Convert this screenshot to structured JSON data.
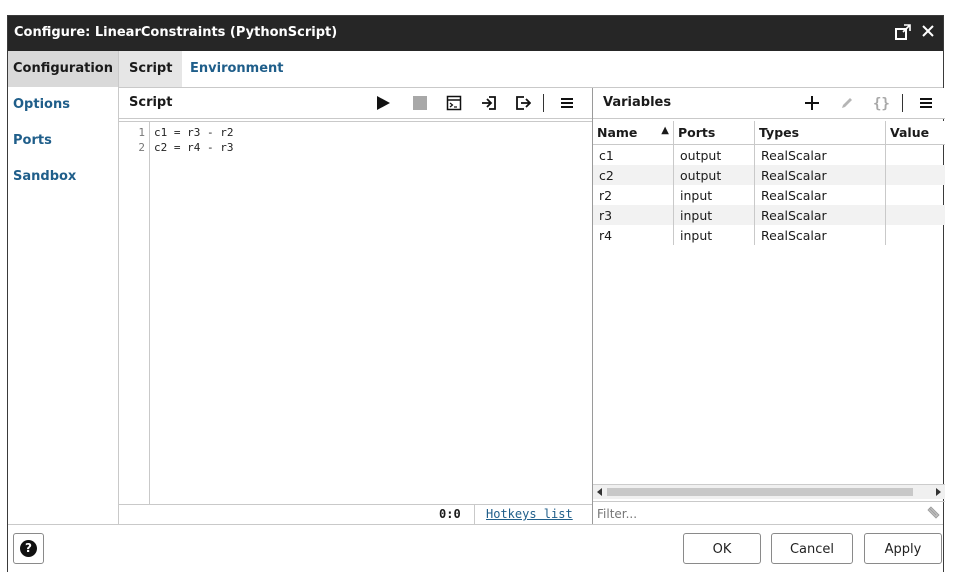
{
  "window": {
    "title": "Configure: LinearConstraints (PythonScript)"
  },
  "sidebar": {
    "items": [
      {
        "label": "Configuration",
        "active": true
      },
      {
        "label": "Options",
        "active": false
      },
      {
        "label": "Ports",
        "active": false
      },
      {
        "label": "Sandbox",
        "active": false
      }
    ]
  },
  "tabs": [
    {
      "label": "Script",
      "active": true
    },
    {
      "label": "Environment",
      "active": false
    }
  ],
  "script_pane": {
    "title": "Script",
    "toolbar_icons": [
      "run-icon",
      "stop-icon",
      "console-icon",
      "import-icon",
      "export-icon",
      "menu-icon"
    ],
    "lines": [
      {
        "num": "1",
        "code": "c1 = r3 - r2"
      },
      {
        "num": "2",
        "code": "c2 = r4 - r3"
      }
    ],
    "cursor_position": "0:0",
    "hotkeys_link": "Hotkeys list"
  },
  "variables_pane": {
    "title": "Variables",
    "toolbar_icons": [
      "add-icon",
      "edit-icon",
      "braces-icon",
      "menu-icon"
    ],
    "columns": [
      "Name",
      "Ports",
      "Types",
      "Value"
    ],
    "sort_indicator": "▲",
    "rows": [
      [
        "c1",
        "output",
        "RealScalar",
        ""
      ],
      [
        "c2",
        "output",
        "RealScalar",
        ""
      ],
      [
        "r2",
        "input",
        "RealScalar",
        ""
      ],
      [
        "r3",
        "input",
        "RealScalar",
        ""
      ],
      [
        "r4",
        "input",
        "RealScalar",
        ""
      ]
    ],
    "filter_placeholder": "Filter..."
  },
  "footer": {
    "ok_label": "OK",
    "cancel_label": "Cancel",
    "apply_label": "Apply",
    "help_glyph": "?"
  },
  "colors": {
    "titlebar": "#262626",
    "link": "#1f5e8a",
    "active_sidebar": "#d9d9d9"
  }
}
